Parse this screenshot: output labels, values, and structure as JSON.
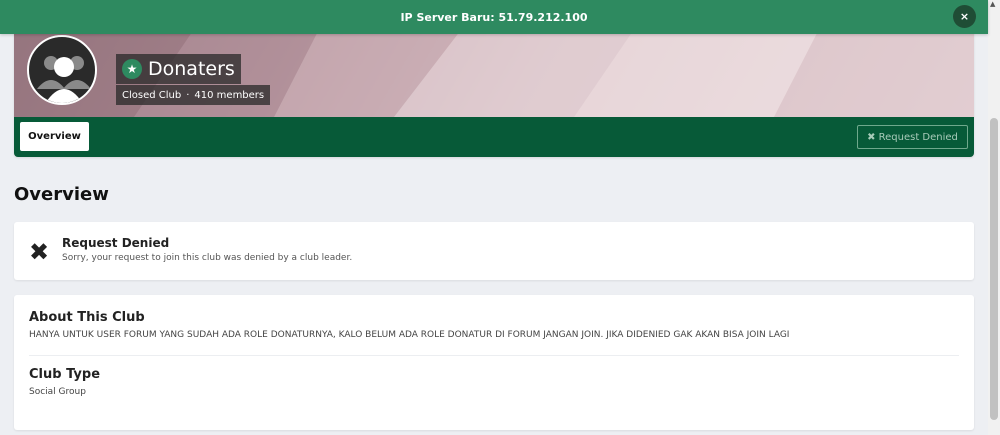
{
  "announcement": {
    "text": "IP Server Baru: 51.79.212.100",
    "close_label": "×"
  },
  "club": {
    "name": "Donaters",
    "privacy": "Closed Club",
    "separator": "·",
    "members": "410 members"
  },
  "nav": {
    "overview_tab": "Overview",
    "request_button": "✖ Request Denied"
  },
  "page_title": "Overview",
  "request_status": {
    "title": "Request Denied",
    "message": "Sorry, your request to join this club was denied by a club leader."
  },
  "about": {
    "heading": "About This Club",
    "description": "HANYA UNTUK USER FORUM YANG SUDAH ADA ROLE DONATURNYA, KALO BELUM ADA ROLE DONATUR DI FORUM JANGAN JOIN. JIKA DIDENIED GAK AKAN BISA JOIN LAGI",
    "type_heading": "Club Type",
    "type_value": "Social Group"
  },
  "colors": {
    "accent": "#2e8a60",
    "nav_bg": "#075a38"
  }
}
